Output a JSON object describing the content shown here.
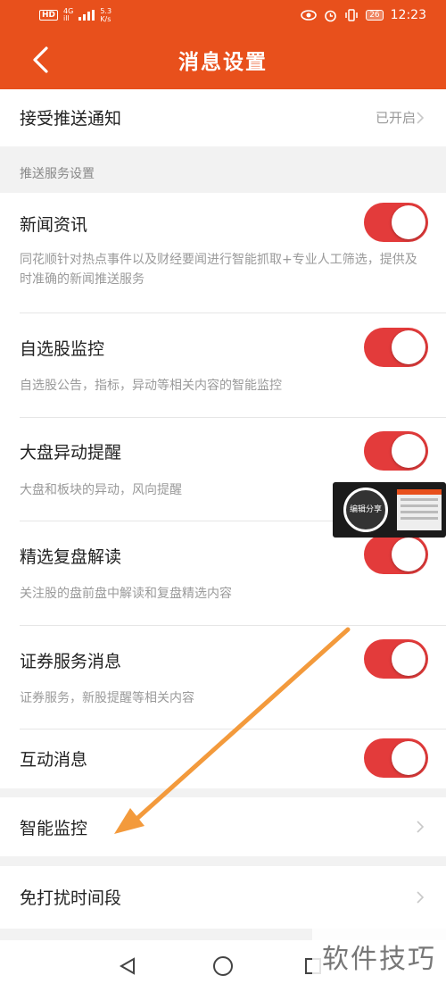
{
  "status_bar": {
    "hd_badge": "HD",
    "network_top": "4G",
    "network_bottom": "ill",
    "speed_value": "5.3",
    "speed_unit": "K/s",
    "battery": "26",
    "time": "12:23"
  },
  "header": {
    "title": "消息设置"
  },
  "push_notification": {
    "label": "接受推送通知",
    "value": "已开启"
  },
  "section_label": "推送服务设置",
  "items": [
    {
      "title": "新闻资讯",
      "desc": "同花顺针对热点事件以及财经要闻进行智能抓取+专业人工筛选，提供及时准确的新闻推送服务",
      "on": true
    },
    {
      "title": "自选股监控",
      "desc": "自选股公告，指标，异动等相关内容的智能监控",
      "on": true
    },
    {
      "title": "大盘异动提醒",
      "desc": "大盘和板块的异动，风向提醒",
      "on": true
    },
    {
      "title": "精选复盘解读",
      "desc": "关注股的盘前盘中解读和复盘精选内容",
      "on": true
    },
    {
      "title": "证券服务消息",
      "desc": "证券服务，新股提醒等相关内容",
      "on": true
    },
    {
      "title": "互动消息",
      "desc": "",
      "on": true
    }
  ],
  "smart_monitor": {
    "label": "智能监控"
  },
  "dnd_period": {
    "label": "免打扰时间段"
  },
  "overlay": {
    "circle_text": "编辑分享"
  },
  "watermark": "软件技巧",
  "colors": {
    "brand": "#e8501c",
    "toggle_on": "#e33b3b",
    "arrow": "#f39a3c"
  }
}
